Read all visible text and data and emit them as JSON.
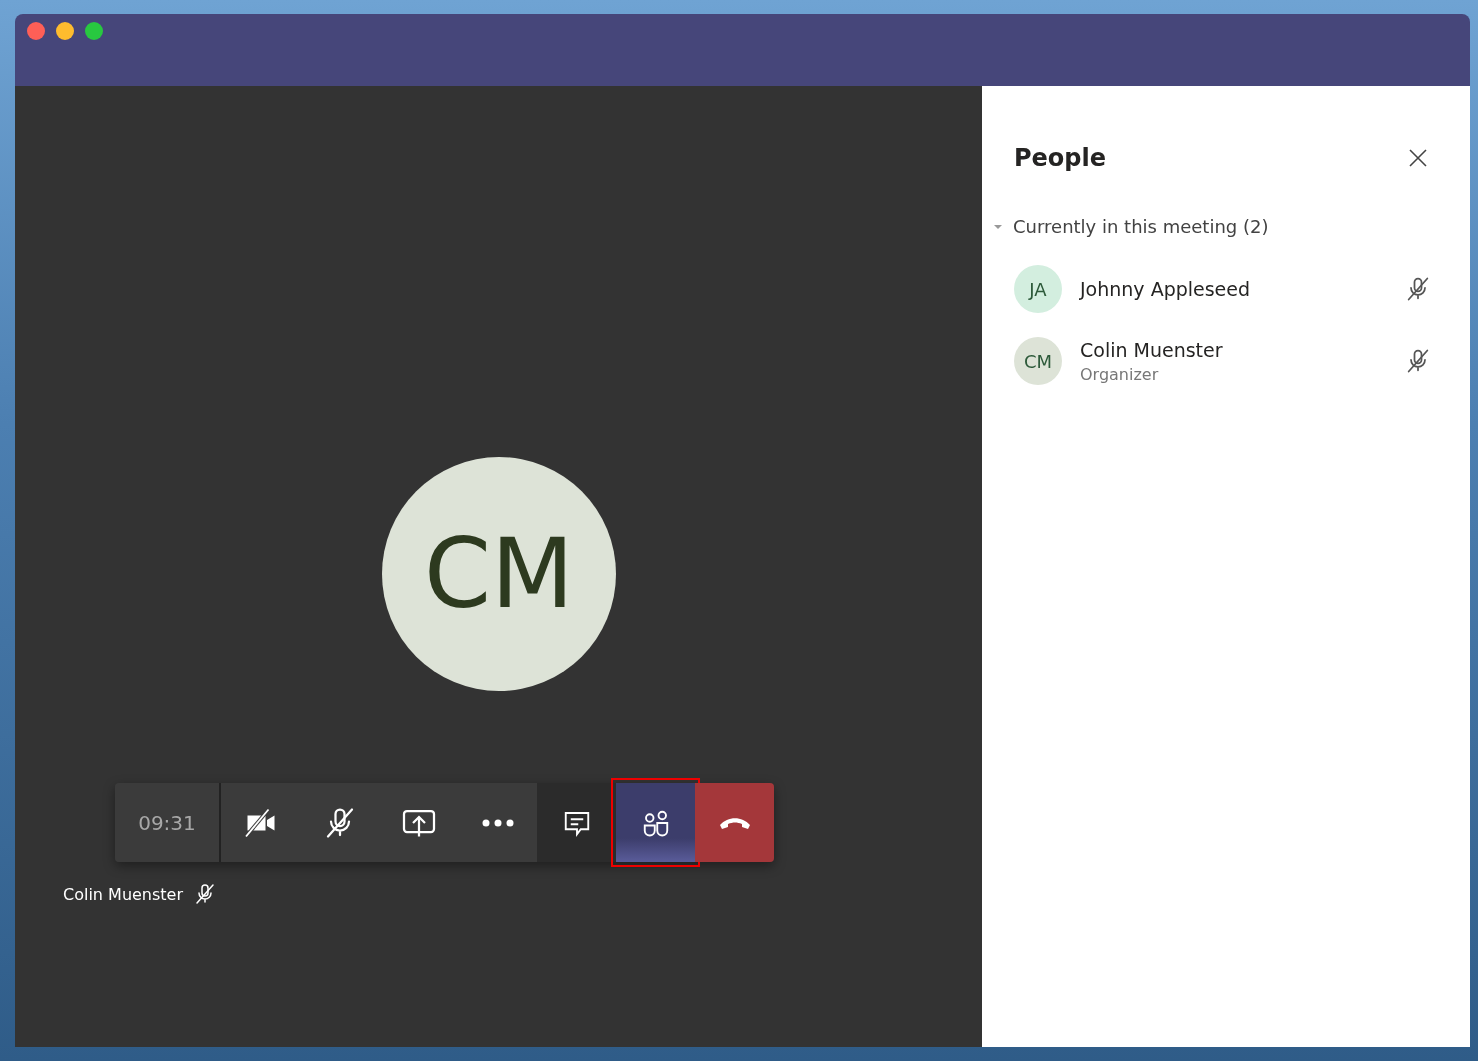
{
  "call": {
    "avatar_initials": "CM",
    "timer": "09:31",
    "controls": [
      {
        "kind": "video-off",
        "selected": false,
        "highlighted": false
      },
      {
        "kind": "mic-off",
        "selected": false,
        "highlighted": false
      },
      {
        "kind": "share",
        "selected": false,
        "highlighted": false
      },
      {
        "kind": "more",
        "selected": false,
        "highlighted": false
      },
      {
        "kind": "chat",
        "selected": false,
        "highlighted": false
      },
      {
        "kind": "people",
        "selected": true,
        "highlighted": true
      },
      {
        "kind": "hangup",
        "selected": false,
        "highlighted": false
      }
    ],
    "self_label": {
      "name": "Colin Muenster",
      "muted": true
    }
  },
  "people_panel": {
    "title": "People",
    "section": {
      "label": "Currently in this meeting (2)",
      "expanded": true
    },
    "participants": [
      {
        "initials": "JA",
        "name": "Johnny Appleseed",
        "color": "#d3eedf",
        "muted": true
      },
      {
        "initials": "CM",
        "name": "Colin Muenster",
        "role": "Organizer",
        "color": "#dde3d7",
        "muted": true
      }
    ]
  }
}
